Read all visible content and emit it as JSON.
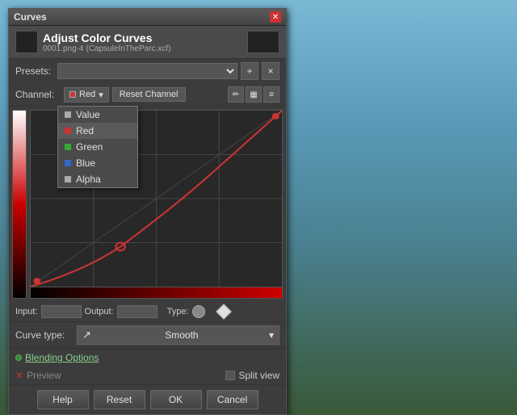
{
  "titleBar": {
    "title": "Curves",
    "closeLabel": "✕"
  },
  "header": {
    "title": "Adjust Color Curves",
    "subtitle": "0001.png-4 (CapsuleInTheParc.xcf)"
  },
  "presets": {
    "label": "Presets:",
    "placeholder": "",
    "addLabel": "+",
    "removeLabel": "×"
  },
  "channel": {
    "label": "Channel:",
    "selectedChannel": "Red",
    "resetLabel": "Reset Channel"
  },
  "dropdown": {
    "items": [
      {
        "name": "Value",
        "dotClass": "value"
      },
      {
        "name": "Red",
        "dotClass": "red"
      },
      {
        "name": "Green",
        "dotClass": "green"
      },
      {
        "name": "Blue",
        "dotClass": "blue"
      },
      {
        "name": "Alpha",
        "dotClass": "alpha"
      }
    ]
  },
  "io": {
    "inputLabel": "Input:",
    "inputValue": "",
    "outputLabel": "Output:",
    "outputValue": "",
    "typeLabel": "Type:"
  },
  "curveType": {
    "label": "Curve type:",
    "value": "Smooth",
    "icon": "↗"
  },
  "blending": {
    "label": "Blending Options"
  },
  "preview": {
    "label": "Preview",
    "splitLabel": "Split view"
  },
  "buttons": {
    "help": "Help",
    "reset": "Reset",
    "ok": "OK",
    "cancel": "Cancel"
  }
}
